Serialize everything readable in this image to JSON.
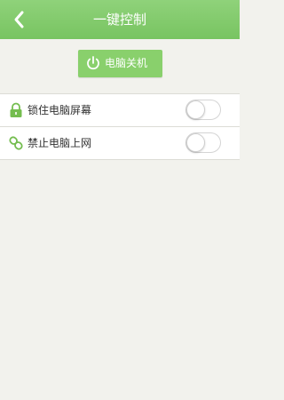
{
  "header": {
    "title": "一键控制",
    "back_icon": "chevron-left-icon",
    "background_color": "#7fc86a"
  },
  "shutdown_button": {
    "label": "电脑关机",
    "icon": "power-icon",
    "background_color": "#89d06c"
  },
  "settings": [
    {
      "label": "锁住电脑屏幕",
      "icon": "lock-icon",
      "enabled": false
    },
    {
      "label": "禁止电脑上网",
      "icon": "link-icon",
      "enabled": false
    }
  ],
  "accent_color": "#74bd4f"
}
